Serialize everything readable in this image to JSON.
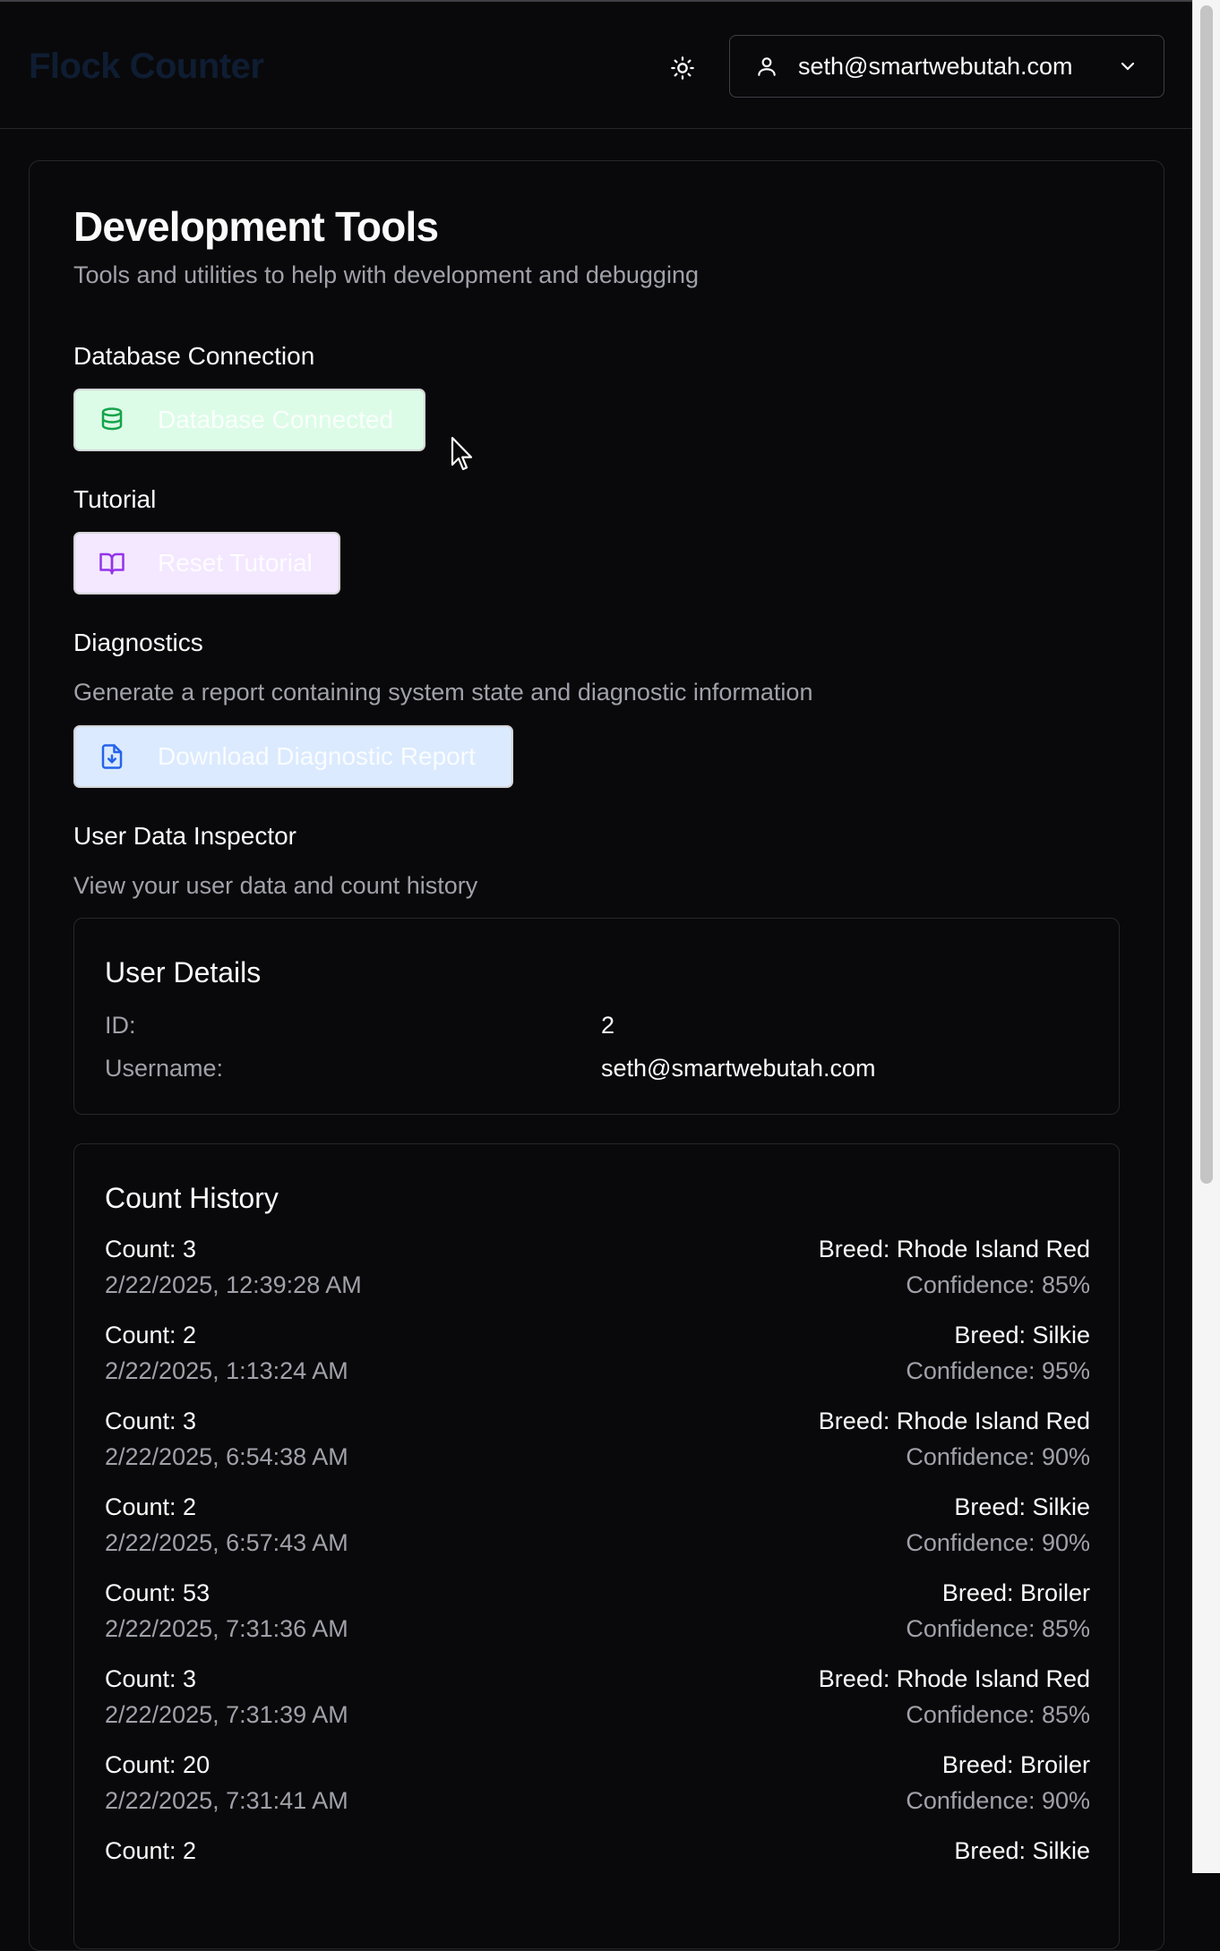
{
  "header": {
    "brand": "Flock Counter",
    "user_email": "seth@smartwebutah.com"
  },
  "page": {
    "title": "Development Tools",
    "subtitle": "Tools and utilities to help with development and debugging"
  },
  "database": {
    "section_label": "Database Connection",
    "button_label": "Database Connected"
  },
  "tutorial": {
    "section_label": "Tutorial",
    "button_label": "Reset Tutorial"
  },
  "diagnostics": {
    "section_label": "Diagnostics",
    "description": "Generate a report containing system state and diagnostic information",
    "button_label": "Download Diagnostic Report"
  },
  "inspector": {
    "section_label": "User Data Inspector",
    "description": "View your user data and count history",
    "user_details": {
      "title": "User Details",
      "id_label": "ID:",
      "id_value": "2",
      "username_label": "Username:",
      "username_value": "seth@smartwebutah.com"
    },
    "count_history": {
      "title": "Count History",
      "rows": [
        {
          "count": "Count: 3",
          "date": "2/22/2025, 12:39:28 AM",
          "breed": "Breed: Rhode Island Red",
          "confidence": "Confidence: 85%"
        },
        {
          "count": "Count: 2",
          "date": "2/22/2025, 1:13:24 AM",
          "breed": "Breed: Silkie",
          "confidence": "Confidence: 95%"
        },
        {
          "count": "Count: 3",
          "date": "2/22/2025, 6:54:38 AM",
          "breed": "Breed: Rhode Island Red",
          "confidence": "Confidence: 90%"
        },
        {
          "count": "Count: 2",
          "date": "2/22/2025, 6:57:43 AM",
          "breed": "Breed: Silkie",
          "confidence": "Confidence: 90%"
        },
        {
          "count": "Count: 53",
          "date": "2/22/2025, 7:31:36 AM",
          "breed": "Breed: Broiler",
          "confidence": "Confidence: 85%"
        },
        {
          "count": "Count: 3",
          "date": "2/22/2025, 7:31:39 AM",
          "breed": "Breed: Rhode Island Red",
          "confidence": "Confidence: 85%"
        },
        {
          "count": "Count: 20",
          "date": "2/22/2025, 7:31:41 AM",
          "breed": "Breed: Broiler",
          "confidence": "Confidence: 90%"
        },
        {
          "count": "Count: 2",
          "date": "",
          "breed": "Breed: Silkie",
          "confidence": ""
        }
      ]
    }
  }
}
